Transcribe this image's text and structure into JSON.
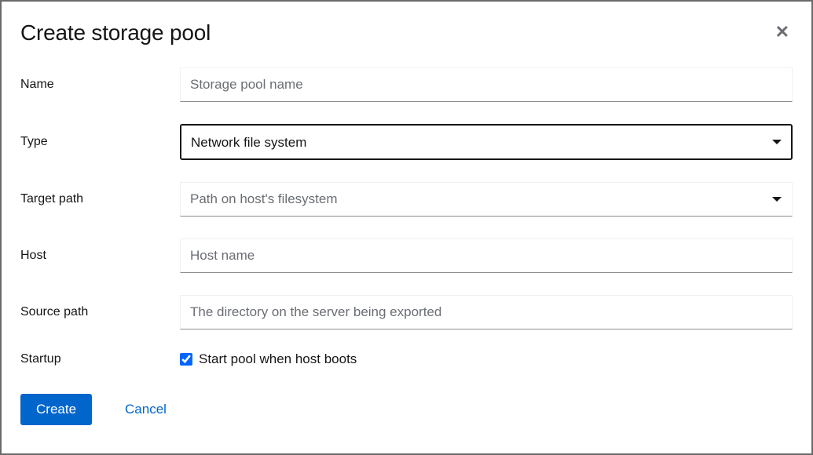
{
  "modal": {
    "title": "Create storage pool"
  },
  "fields": {
    "name": {
      "label": "Name",
      "placeholder": "Storage pool name",
      "value": ""
    },
    "type": {
      "label": "Type",
      "value": "Network file system"
    },
    "target_path": {
      "label": "Target path",
      "placeholder": "Path on host's filesystem",
      "value": ""
    },
    "host": {
      "label": "Host",
      "placeholder": "Host name",
      "value": ""
    },
    "source_path": {
      "label": "Source path",
      "placeholder": "The directory on the server being exported",
      "value": ""
    },
    "startup": {
      "label": "Startup",
      "checkbox_label": "Start pool when host boots",
      "checked": true
    }
  },
  "buttons": {
    "create": "Create",
    "cancel": "Cancel"
  }
}
